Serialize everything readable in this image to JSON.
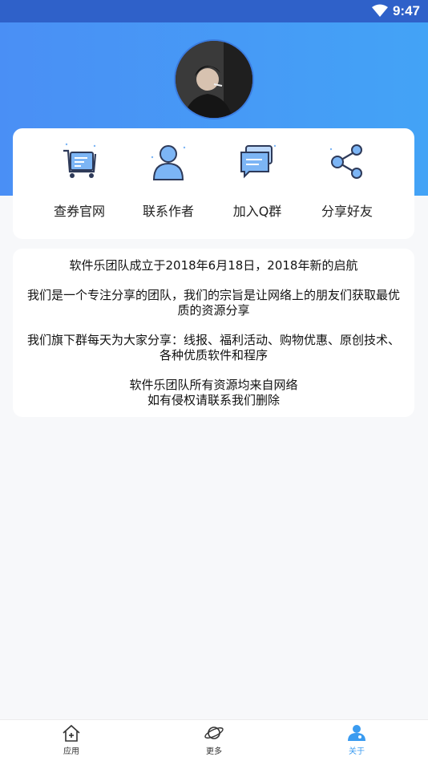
{
  "status_bar": {
    "time": "9:47",
    "wifi_icon": "wifi-icon"
  },
  "colors": {
    "header": "#4a8ff5",
    "accent": "#3a9bf0",
    "icon_fill": "#7cb5f5",
    "icon_stroke": "#2e3a59"
  },
  "profile": {
    "avatar_icon": "profile-photo"
  },
  "shortcuts": [
    {
      "label": "查券官网",
      "icon": "cart-icon"
    },
    {
      "label": "联系作者",
      "icon": "person-icon"
    },
    {
      "label": "加入Q群",
      "icon": "chat-icon"
    },
    {
      "label": "分享好友",
      "icon": "share-icon"
    }
  ],
  "about": {
    "line1": "软件乐团队成立于2018年6月18日，2018年新的启航",
    "p2_line1": "我们是一个专注分享的团队，我们的宗旨是让网络上的朋友们获取最优",
    "p2_line2": "质的资源分享",
    "p3_line1": "我们旗下群每天为大家分享：线报、福利活动、购物优惠、原创技术、",
    "p3_line2": "各种优质软件和程序",
    "p4_line1": "软件乐团队所有资源均来自网络",
    "p4_line2": "如有侵权请联系我们删除"
  },
  "tabs": [
    {
      "label": "应用",
      "icon": "home-icon",
      "active": false
    },
    {
      "label": "更多",
      "icon": "planet-icon",
      "active": false
    },
    {
      "label": "关于",
      "icon": "user-icon",
      "active": true
    }
  ]
}
